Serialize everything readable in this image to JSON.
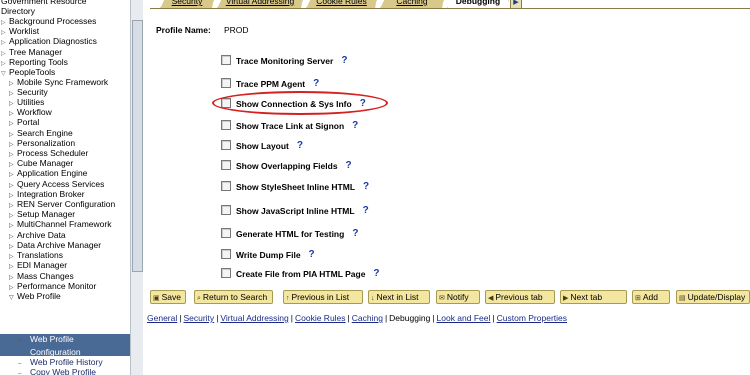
{
  "nav": {
    "items": [
      {
        "label": "Government Resource",
        "level": 0,
        "marker": ""
      },
      {
        "label": "Directory",
        "level": 0,
        "marker": "none"
      },
      {
        "label": "Background Processes",
        "level": 0,
        "marker": "tri"
      },
      {
        "label": "Worklist",
        "level": 0,
        "marker": "tri"
      },
      {
        "label": "Application Diagnostics",
        "level": 0,
        "marker": "tri"
      },
      {
        "label": "Tree Manager",
        "level": 0,
        "marker": "tri"
      },
      {
        "label": "Reporting Tools",
        "level": 0,
        "marker": "tri"
      },
      {
        "label": "PeopleTools",
        "level": 0,
        "marker": "open"
      },
      {
        "label": "Mobile Sync Framework",
        "level": 1,
        "marker": "tri"
      },
      {
        "label": "Security",
        "level": 1,
        "marker": "tri"
      },
      {
        "label": "Utilities",
        "level": 1,
        "marker": "tri"
      },
      {
        "label": "Workflow",
        "level": 1,
        "marker": "tri"
      },
      {
        "label": "Portal",
        "level": 1,
        "marker": "tri"
      },
      {
        "label": "Search Engine",
        "level": 1,
        "marker": "tri"
      },
      {
        "label": "Personalization",
        "level": 1,
        "marker": "tri"
      },
      {
        "label": "Process Scheduler",
        "level": 1,
        "marker": "tri"
      },
      {
        "label": "Cube Manager",
        "level": 1,
        "marker": "tri"
      },
      {
        "label": "Application Engine",
        "level": 1,
        "marker": "tri"
      },
      {
        "label": "Query Access Services",
        "level": 1,
        "marker": "tri"
      },
      {
        "label": "Integration Broker",
        "level": 1,
        "marker": "tri"
      },
      {
        "label": "REN Server Configuration",
        "level": 1,
        "marker": "tri"
      },
      {
        "label": "Setup Manager",
        "level": 1,
        "marker": "tri"
      },
      {
        "label": "MultiChannel Framework",
        "level": 1,
        "marker": "tri"
      },
      {
        "label": "Archive Data",
        "level": 1,
        "marker": "tri"
      },
      {
        "label": "Data Archive Manager",
        "level": 1,
        "marker": "tri"
      },
      {
        "label": "Translations",
        "level": 1,
        "marker": "tri"
      },
      {
        "label": "EDI Manager",
        "level": 1,
        "marker": "tri"
      },
      {
        "label": "Mass Changes",
        "level": 1,
        "marker": "tri"
      },
      {
        "label": "Performance Monitor",
        "level": 1,
        "marker": "tri"
      },
      {
        "label": "Web Profile",
        "level": 1,
        "marker": "open"
      }
    ],
    "selected": [
      "Web Profile",
      "Configuration"
    ],
    "after": [
      "Web Profile History",
      "Copy Web Profile"
    ]
  },
  "tabs": [
    {
      "label": "Security"
    },
    {
      "label": "Virtual Addressing"
    },
    {
      "label": "Cookie Rules"
    },
    {
      "label": "Caching"
    },
    {
      "label": "Debugging",
      "active": true
    }
  ],
  "profile": {
    "label": "Profile Name:",
    "value": "PROD"
  },
  "options": [
    {
      "label": "Trace Monitoring Server",
      "help": "?"
    },
    {
      "label": "Trace PPM Agent",
      "help": "?"
    },
    {
      "label": "Show Connection & Sys Info",
      "help": "?",
      "highlighted": true
    },
    {
      "label": "Show Trace Link at Signon",
      "help": "?"
    },
    {
      "label": "Show Layout",
      "help": "?"
    },
    {
      "label": "Show Overlapping Fields",
      "help": "?"
    },
    {
      "label": "Show StyleSheet Inline HTML",
      "help": "?"
    },
    {
      "label": "Show JavaScript Inline HTML",
      "help": "?"
    },
    {
      "label": "Generate HTML for Testing",
      "help": "?"
    },
    {
      "label": "Write Dump File",
      "help": "?"
    },
    {
      "label": "Create File from PIA HTML Page",
      "help": "?"
    }
  ],
  "toolbar": [
    {
      "label": "Save",
      "icon": "save-icon"
    },
    {
      "label": "Return to Search",
      "icon": "search-icon"
    },
    {
      "label": "Previous in List",
      "icon": "up-arrow-icon"
    },
    {
      "label": "Next in List",
      "icon": "down-arrow-icon"
    },
    {
      "label": "Notify",
      "icon": "notify-icon"
    },
    {
      "label": "Previous tab",
      "icon": "prev-tab-icon"
    },
    {
      "label": "Next tab",
      "icon": "next-tab-icon"
    },
    {
      "label": "Add",
      "icon": "add-icon"
    },
    {
      "label": "Update/Display",
      "icon": "update-icon"
    }
  ],
  "page_links": [
    {
      "label": "General",
      "current": false
    },
    {
      "label": "Security",
      "current": false
    },
    {
      "label": "Virtual Addressing",
      "current": false
    },
    {
      "label": "Cookie Rules",
      "current": false
    },
    {
      "label": "Caching",
      "current": false
    },
    {
      "label": "Debugging",
      "current": true
    },
    {
      "label": "Look and Feel",
      "current": false
    },
    {
      "label": "Custom Properties",
      "current": false
    }
  ],
  "colors": {
    "accent": "#4a6a96",
    "highlight_oval": "#d42020",
    "button": "#f2e6a0",
    "tab": "#d8c88a"
  }
}
